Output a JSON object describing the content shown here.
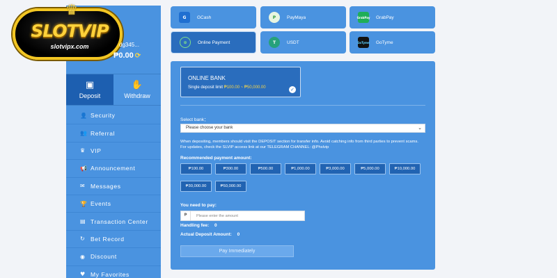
{
  "brand": {
    "name": "SLOTVIP",
    "domain": "slotvipx.com"
  },
  "user": {
    "name_partial": "dg345...",
    "balance": "₱0.00"
  },
  "tabs": [
    {
      "label": "Deposit",
      "icon": "deposit-icon",
      "active": true
    },
    {
      "label": "Withdraw",
      "icon": "withdraw-icon",
      "active": false
    }
  ],
  "menu": [
    {
      "label": "Security",
      "icon": "user-lock-icon"
    },
    {
      "label": "Referral",
      "icon": "users-icon"
    },
    {
      "label": "VIP",
      "icon": "crown-icon"
    },
    {
      "label": "Announcement",
      "icon": "megaphone-icon"
    },
    {
      "label": "Messages",
      "icon": "envelope-icon"
    },
    {
      "label": "Events",
      "icon": "trophy-icon"
    },
    {
      "label": "Transaction Center",
      "icon": "receipt-icon"
    },
    {
      "label": "Bet Record",
      "icon": "refresh-icon"
    },
    {
      "label": "Discount",
      "icon": "discount-icon"
    },
    {
      "label": "My Favorites",
      "icon": "heart-icon"
    }
  ],
  "methods": [
    {
      "label": "GCash",
      "logo": "G",
      "selected": false
    },
    {
      "label": "PayMaya",
      "logo": "P",
      "selected": false
    },
    {
      "label": "GrabPay",
      "logo": "GrabPay",
      "selected": false
    },
    {
      "label": "Online Payment",
      "logo": "⊕",
      "selected": true
    },
    {
      "label": "USDT",
      "logo": "T",
      "selected": false
    },
    {
      "label": "GoTyme",
      "logo": "GoTyme",
      "selected": false
    }
  ],
  "bank_card": {
    "title": "ONLINE BANK",
    "limit_prefix": "Single deposit limit ",
    "limit_range": "₱100.00 ~ ₱50,000.00"
  },
  "form": {
    "select_bank_label": "Select bank：",
    "select_bank_value": "Please choose your bank",
    "notice": "When depositing, members should visit the DEPOSIT section for transfer info. Avoid catching info from third parties to prevent scams. For updates, check the SLVIP access link at our TELEGRAM CHANNEL: @Phslvip",
    "recommended_label": "Recommended payment amount:",
    "amounts": [
      "₱100.00",
      "₱300.00",
      "₱500.00",
      "₱1,000.00",
      "₱3,000.00",
      "₱5,000.00",
      "₱10,000.00",
      "₱30,000.00",
      "₱50,000.00"
    ],
    "need_to_pay_label": "You need to pay:",
    "currency_prefix": "₱",
    "amount_placeholder": "Please enter the amount",
    "handling_fee_label": "Handling fee:",
    "handling_fee_value": "0",
    "actual_deposit_label": "Actual Deposit Amount:",
    "actual_deposit_value": "0",
    "pay_button": "Pay Immediately"
  },
  "colors": {
    "panel": "#4a93e0",
    "selected": "#2a6dbd",
    "accent_yellow": "#f3d34a",
    "page_bg": "#f2f4f8"
  }
}
